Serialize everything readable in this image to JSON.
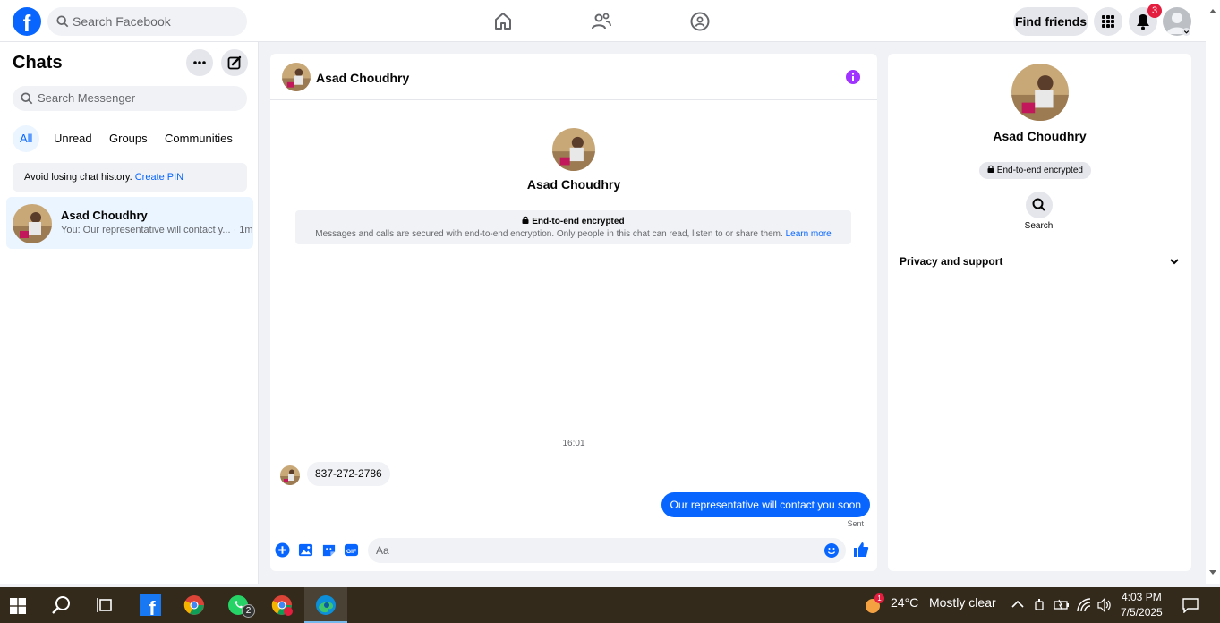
{
  "top_nav": {
    "search_placeholder": "Search Facebook",
    "find_friends_label": "Find friends",
    "notification_count": "3",
    "icons": [
      "facebook-logo",
      "home-icon",
      "friends-icon",
      "groups-icon",
      "menu-grid-icon",
      "bell-icon",
      "profile-avatar"
    ]
  },
  "left_panel": {
    "title": "Chats",
    "search_placeholder": "Search Messenger",
    "filters": [
      "All",
      "Unread",
      "Groups",
      "Communities"
    ],
    "active_filter": "All",
    "pin_notice": {
      "text": "Avoid losing chat history.",
      "link": "Create PIN"
    },
    "conversations": [
      {
        "name": "Asad Choudhry",
        "preview": "You: Our representative will contact y... · 1m"
      }
    ]
  },
  "chat": {
    "contact_name": "Asad Choudhry",
    "encryption_title": "End-to-end encrypted",
    "encryption_text": "Messages and calls are secured with end-to-end encryption. Only people in this chat can read, listen to or share them.",
    "learn_more": "Learn more",
    "timestamp": "16:01",
    "messages": [
      {
        "direction": "in",
        "text": "837-272-2786"
      },
      {
        "direction": "out",
        "text": "Our representative will contact you soon"
      }
    ],
    "status": "Sent",
    "composer_placeholder": "Aa"
  },
  "right_panel": {
    "name": "Asad Choudhry",
    "encryption_badge": "End-to-end encrypted",
    "search_label": "Search",
    "privacy_section": "Privacy and support"
  },
  "taskbar": {
    "whatsapp_badge": "2",
    "weather_badge": "1",
    "temperature": "24°C",
    "weather_text": "Mostly clear",
    "time": "4:03 PM",
    "date": "7/5/2025"
  },
  "colors": {
    "accent": "#0866ff",
    "badge": "#e41e3f",
    "info": "#a033ff"
  }
}
